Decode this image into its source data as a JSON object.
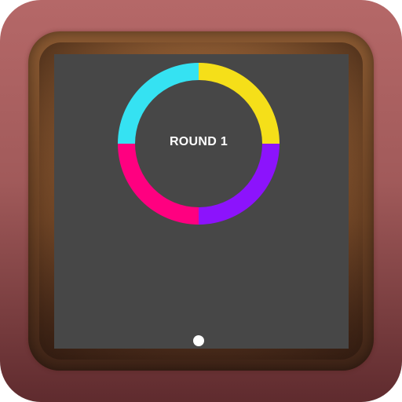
{
  "game": {
    "round_label": "ROUND 1",
    "ring": {
      "segments": [
        {
          "name": "top-right",
          "color": "#f5df19"
        },
        {
          "name": "bottom-right",
          "color": "#8c13fc"
        },
        {
          "name": "bottom-left",
          "color": "#ff0080"
        },
        {
          "name": "top-left",
          "color": "#35e2f2"
        }
      ]
    },
    "screen_color": "#474747",
    "ball_color": "#ffffff"
  }
}
